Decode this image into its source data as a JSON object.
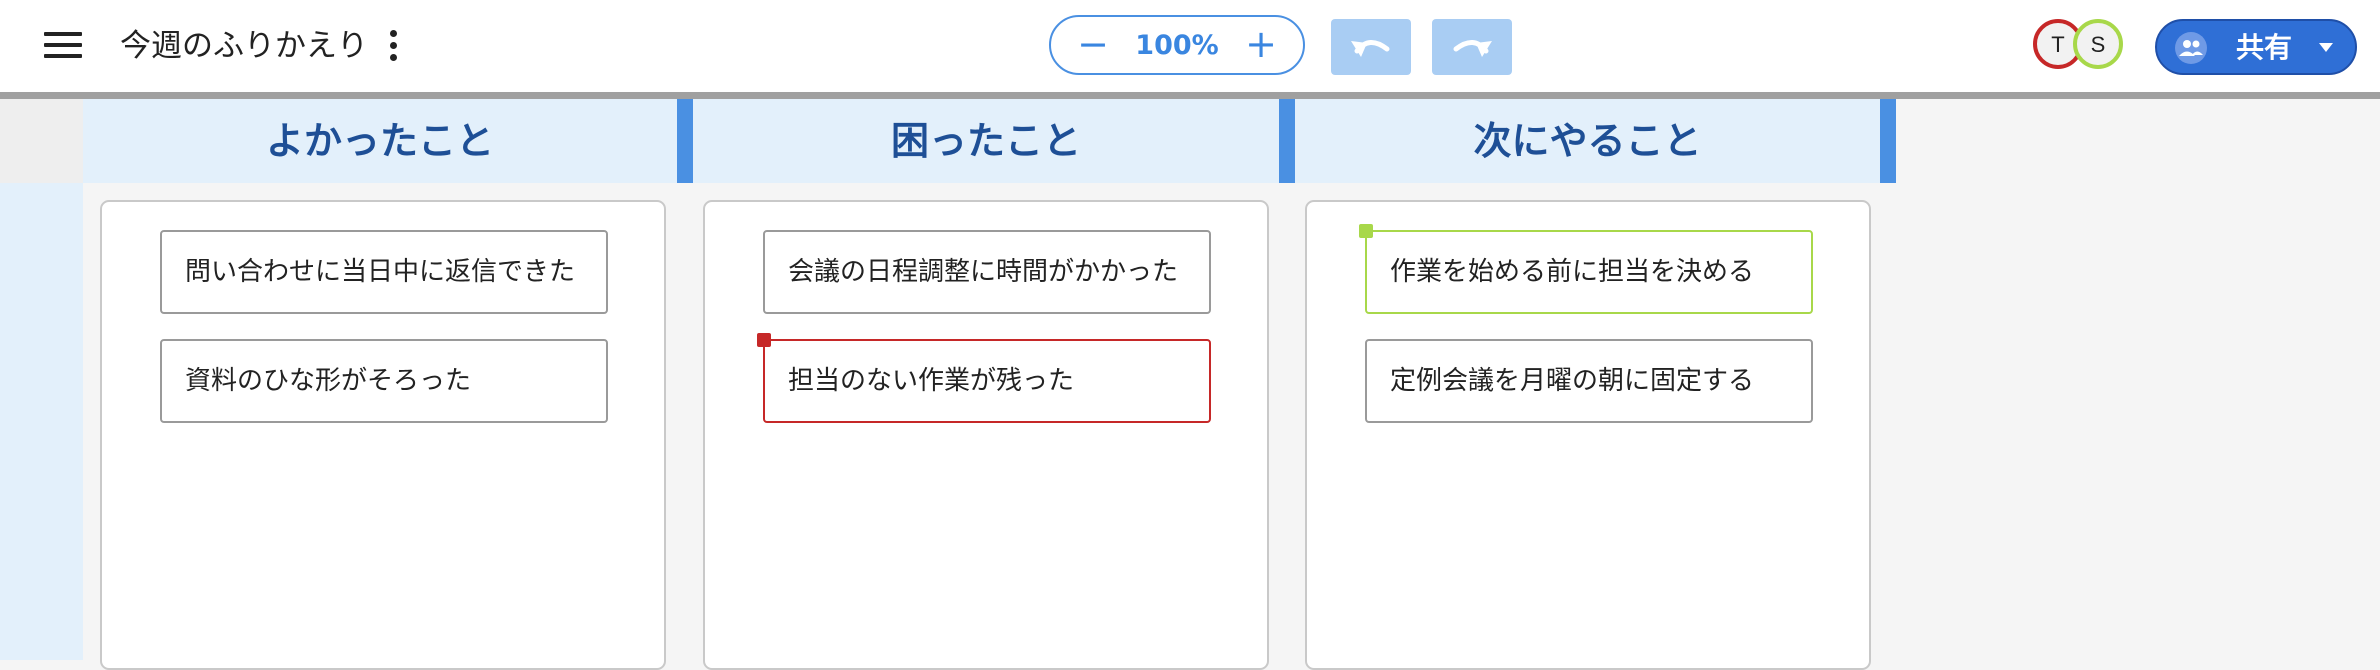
{
  "toolbar": {
    "menu_icon": "hamburger-menu-icon",
    "title": "今週のふりかえり",
    "more_icon": "more-vertical-icon",
    "zoom": {
      "minus": "−",
      "value": "100%",
      "plus": "+"
    },
    "undo_icon": "undo-icon",
    "redo_icon": "redo-icon",
    "avatars": [
      "T",
      "S"
    ],
    "share": {
      "icon": "people-icon",
      "label": "共有",
      "caret_icon": "caret-down-icon"
    }
  },
  "columns": [
    {
      "title": "よかったこと",
      "cards": [
        "問い合わせに当日中に返信できた",
        "資料のひな形がそろった"
      ]
    },
    {
      "title": "困ったこと",
      "cards": [
        "会議の日程調整に時間がかかった",
        "担当のない作業が残った"
      ]
    },
    {
      "title": "次にやること",
      "cards": [
        "作業を始める前に担当を決める",
        "定例会議を月曜の朝に固定する"
      ]
    }
  ],
  "colors": {
    "accent": "#4a90e2",
    "header_bg": "#e3f0fb",
    "header_text": "#1e4f96",
    "user_t": "#c62828",
    "user_s": "#a8d84a",
    "share_bg": "#2f6fd6"
  }
}
